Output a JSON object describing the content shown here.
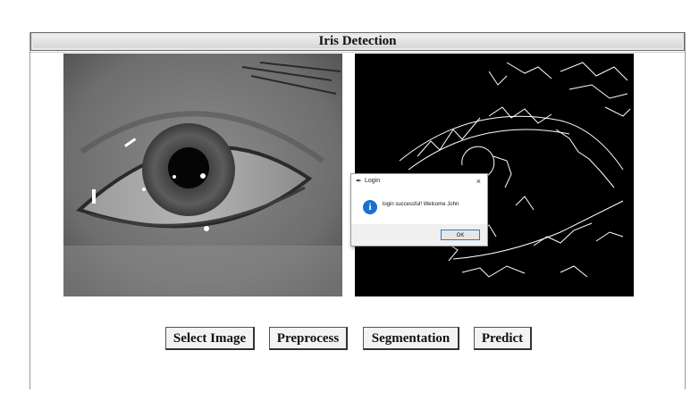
{
  "window": {
    "title": "Iris Detection"
  },
  "buttons": {
    "select_image": "Select Image",
    "preprocess": "Preprocess",
    "segmentation": "Segmentation",
    "predict": "Predict"
  },
  "dialog": {
    "title": "Login",
    "message": "login successful! Welcome John",
    "ok_label": "OK",
    "close_glyph": "×",
    "icon": "info-icon"
  },
  "panes": {
    "left": "grayscale-eye-image",
    "right": "edge-detected-eye-image"
  }
}
